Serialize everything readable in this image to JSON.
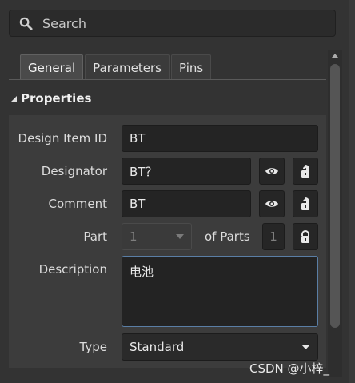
{
  "search": {
    "placeholder": "Search"
  },
  "tabs": [
    {
      "label": "General",
      "active": true
    },
    {
      "label": "Parameters",
      "active": false
    },
    {
      "label": "Pins",
      "active": false
    }
  ],
  "section": {
    "title": "Properties"
  },
  "fields": {
    "design_item_id": {
      "label": "Design Item ID",
      "value": "BT"
    },
    "designator": {
      "label": "Designator",
      "value": "BT？"
    },
    "comment": {
      "label": "Comment",
      "value": "BT"
    },
    "part": {
      "label": "Part",
      "value": "1",
      "of_parts_label": "of Parts",
      "of_parts_value": "1"
    },
    "description": {
      "label": "Description",
      "value": "电池"
    },
    "type": {
      "label": "Type",
      "value": "Standard"
    }
  },
  "icons": {
    "search": "search-icon",
    "visibility": "eye-icon",
    "unlocked": "unlock-icon",
    "locked": "lock-icon",
    "dropdown": "chevron-down-icon"
  },
  "watermark": "CSDN @小梓_"
}
